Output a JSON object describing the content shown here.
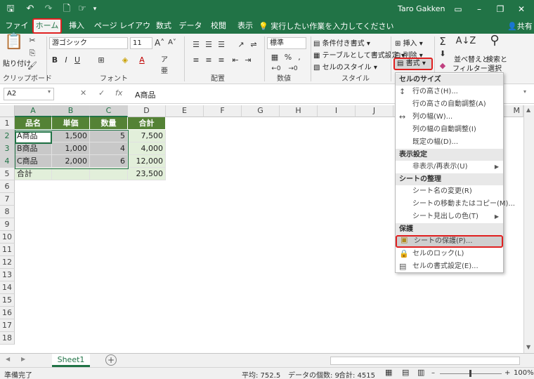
{
  "titlebar": {
    "title": "Taro Gakken",
    "undo_icon": "undo-icon",
    "redo_icon": "redo-icon"
  },
  "tabs": [
    "ファイル",
    "ホーム",
    "挿入",
    "ページ レイアウト",
    "数式",
    "データ",
    "校閲",
    "表示"
  ],
  "tell_me": "実行したい作業を入力してください",
  "share": "共有",
  "ribbon": {
    "paste": "貼り付け",
    "clipboard": "クリップボード",
    "font_name": "游ゴシック",
    "font_size": "11",
    "font_group": "フォント",
    "align_group": "配置",
    "number_format": "標準",
    "number_group": "数値",
    "cond_format": "条件付き書式",
    "table_format": "テーブルとして書式設定",
    "cell_style": "セルのスタイル",
    "style_group": "スタイル",
    "insert": "挿入",
    "delete": "削除",
    "format": "書式",
    "sort_filter_1": "並べ替えと",
    "sort_filter_2": "フィルター",
    "find_select_1": "検索と",
    "find_select_2": "選択"
  },
  "formula": {
    "name_box": "A2",
    "value": "A商品"
  },
  "columns": [
    "A",
    "B",
    "C",
    "D",
    "E",
    "F",
    "G",
    "H",
    "I",
    "J",
    "K",
    "L",
    "M"
  ],
  "rows": [
    "1",
    "2",
    "3",
    "4",
    "5",
    "6",
    "7",
    "8",
    "9",
    "10",
    "11",
    "12",
    "13",
    "14",
    "15",
    "16",
    "17",
    "18"
  ],
  "table": {
    "headers": [
      "品名",
      "単価",
      "数量",
      "合計"
    ],
    "rows": [
      [
        "A商品",
        "1,500",
        "5",
        "7,500"
      ],
      [
        "B商品",
        "1,000",
        "4",
        "4,000"
      ],
      [
        "C商品",
        "2,000",
        "6",
        "12,000"
      ],
      [
        "合計",
        "",
        "",
        "23,500"
      ]
    ]
  },
  "menu": {
    "sec_cell_size": "セルのサイズ",
    "row_height": "行の高さ(H)...",
    "row_autofit": "行の高さの自動調整(A)",
    "col_width": "列の幅(W)...",
    "col_autofit": "列の幅の自動調整(I)",
    "default_width": "既定の幅(D)...",
    "sec_visibility": "表示設定",
    "hide_unhide": "非表示/再表示(U)",
    "sec_organize": "シートの整理",
    "rename": "シート名の変更(R)",
    "move_copy": "シートの移動またはコピー(M)...",
    "tab_color": "シート見出しの色(T)",
    "sec_protect": "保護",
    "protect_sheet": "シートの保護(P)...",
    "lock_cell": "セルのロック(L)",
    "format_cells": "セルの書式設定(E)..."
  },
  "sheet": {
    "name": "Sheet1"
  },
  "status": {
    "ready": "準備完了",
    "average": "平均: 752.5",
    "count": "データの個数: 9",
    "sum": "合計: 4515",
    "zoom": "100%"
  },
  "colors": {
    "excel_green": "#217346",
    "header_green": "#548235",
    "highlight_red": "#e02020"
  }
}
